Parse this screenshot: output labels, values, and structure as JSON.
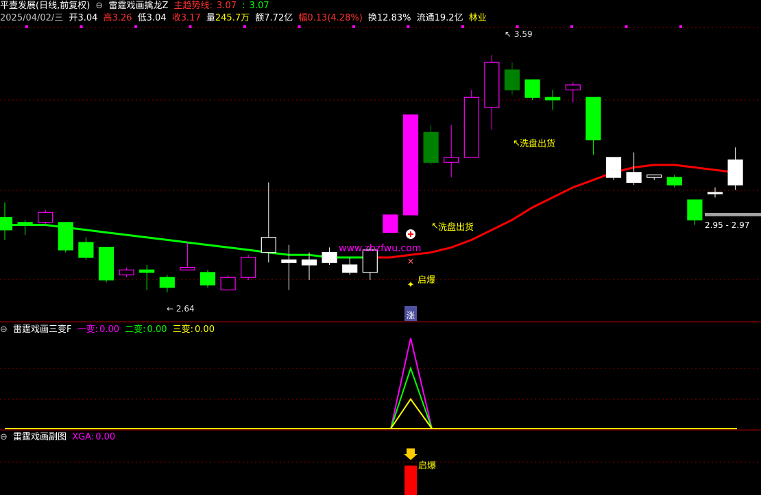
{
  "header": {
    "title": "平壹发展(日线,前复权)",
    "indicator_name": "雷霆戏画擒龙Z",
    "trend_label": "主趋势线:",
    "trend_v1": "3.07",
    "trend_v2": "3.07",
    "date": "2025/04/02/三",
    "open": "开3.04",
    "high_label": "高",
    "high_value": "3.26",
    "low_label": "低",
    "low_value": "3.04",
    "close_label": "收",
    "close_value": "3.17",
    "volume_label": "量",
    "volume_value": "245.7万",
    "amount_label": "额",
    "amount_value": "7.72亿",
    "change_label": "幅",
    "change_value": "0.13(4.28%)",
    "turnover": "换12.83%",
    "float": "流通19.2亿",
    "sector": "林业"
  },
  "panel2": {
    "name": "雷霆戏画三变F",
    "l1": "一变:",
    "v1": "0.00",
    "l2": "二变:",
    "v2": "0.00",
    "l3": "三变:",
    "v3": "0.00"
  },
  "panel3": {
    "name": "雷霆戏画副图",
    "l1": "XGA:",
    "v1": "0.00"
  },
  "annotations": {
    "high_mark": "3.59",
    "low_mark": "2.64",
    "range": "2.95 - 2.97",
    "wash1": "洗盘出货",
    "wash2": "洗盘出货",
    "qibao1": "启爆",
    "qibao2": "启爆",
    "zhang": "涨",
    "watermark": "www.zbzfwu.com"
  },
  "colors": {
    "up": "#ff00ff",
    "down_bright": "#00ff00",
    "down_dark": "#008000",
    "white": "#ffffff",
    "ma_up": "#ff0000",
    "ma_down": "#00ff00",
    "text_red": "#ff3030",
    "text_yellow": "#ffff00",
    "text_magenta": "#ff00ff",
    "grid": "#8b0000"
  },
  "chart_data": {
    "type": "candlestick",
    "candles": [
      {
        "open": 2.94,
        "close": 2.89,
        "high": 3.0,
        "low": 2.85
      },
      {
        "open": 2.92,
        "close": 2.91,
        "high": 2.93,
        "low": 2.87
      },
      {
        "open": 2.92,
        "close": 2.96,
        "high": 2.97,
        "low": 2.91
      },
      {
        "open": 2.92,
        "close": 2.81,
        "high": 2.92,
        "low": 2.8
      },
      {
        "open": 2.84,
        "close": 2.78,
        "high": 2.86,
        "low": 2.77
      },
      {
        "open": 2.82,
        "close": 2.69,
        "high": 2.82,
        "low": 2.68
      },
      {
        "open": 2.71,
        "close": 2.73,
        "high": 2.74,
        "low": 2.7
      },
      {
        "open": 2.73,
        "close": 2.72,
        "high": 2.75,
        "low": 2.65
      },
      {
        "open": 2.7,
        "close": 2.66,
        "high": 2.71,
        "low": 2.64
      },
      {
        "open": 2.73,
        "close": 2.74,
        "high": 2.84,
        "low": 2.73
      },
      {
        "open": 2.72,
        "close": 2.67,
        "high": 2.73,
        "low": 2.66
      },
      {
        "open": 2.65,
        "close": 2.7,
        "high": 2.71,
        "low": 2.65
      },
      {
        "open": 2.7,
        "close": 2.78,
        "high": 2.79,
        "low": 2.69
      },
      {
        "open": 2.8,
        "close": 2.86,
        "high": 3.08,
        "low": 2.76
      },
      {
        "open": 2.77,
        "close": 2.76,
        "high": 2.83,
        "low": 2.65
      },
      {
        "open": 2.77,
        "close": 2.75,
        "high": 2.8,
        "low": 2.69
      },
      {
        "open": 2.8,
        "close": 2.76,
        "high": 2.82,
        "low": 2.75
      },
      {
        "open": 2.75,
        "close": 2.72,
        "high": 2.78,
        "low": 2.71
      },
      {
        "open": 2.72,
        "close": 2.81,
        "high": 2.82,
        "low": 2.69
      },
      {
        "open": 2.88,
        "close": 2.95,
        "high": 2.95,
        "low": 2.88
      },
      {
        "open": 2.95,
        "close": 3.35,
        "high": 3.35,
        "low": 2.95
      },
      {
        "open": 3.28,
        "close": 3.16,
        "high": 3.31,
        "low": 3.15
      },
      {
        "open": 3.16,
        "close": 3.18,
        "high": 3.31,
        "low": 3.1
      },
      {
        "open": 3.18,
        "close": 3.42,
        "high": 3.45,
        "low": 3.18
      },
      {
        "open": 3.38,
        "close": 3.56,
        "high": 3.59,
        "low": 3.29
      },
      {
        "open": 3.53,
        "close": 3.45,
        "high": 3.56,
        "low": 3.43
      },
      {
        "open": 3.49,
        "close": 3.42,
        "high": 3.49,
        "low": 3.41
      },
      {
        "open": 3.42,
        "close": 3.41,
        "high": 3.45,
        "low": 3.37
      },
      {
        "open": 3.45,
        "close": 3.47,
        "high": 3.48,
        "low": 3.4
      },
      {
        "open": 3.42,
        "close": 3.25,
        "high": 3.42,
        "low": 3.19
      },
      {
        "open": 3.18,
        "close": 3.1,
        "high": 3.18,
        "low": 3.09
      },
      {
        "open": 3.12,
        "close": 3.08,
        "high": 3.2,
        "low": 3.07
      },
      {
        "open": 3.1,
        "close": 3.11,
        "high": 3.11,
        "low": 3.09
      },
      {
        "open": 3.1,
        "close": 3.07,
        "high": 3.11,
        "low": 3.06
      },
      {
        "open": 3.01,
        "close": 2.93,
        "high": 3.01,
        "low": 2.91
      },
      {
        "open": 3.04,
        "close": 3.04,
        "high": 3.06,
        "low": 3.02
      },
      {
        "open": 3.17,
        "close": 3.07,
        "high": 3.22,
        "low": 3.05
      }
    ],
    "ma": [
      2.91,
      2.91,
      2.91,
      2.9,
      2.89,
      2.88,
      2.87,
      2.86,
      2.85,
      2.84,
      2.83,
      2.82,
      2.81,
      2.8,
      2.79,
      2.79,
      2.78,
      2.78,
      2.78,
      2.78,
      2.79,
      2.8,
      2.82,
      2.85,
      2.89,
      2.93,
      2.98,
      3.02,
      3.06,
      3.09,
      3.12,
      3.14,
      3.15,
      3.15,
      3.14,
      3.13,
      3.12
    ],
    "ma_color_switch": 18,
    "ylim": [
      2.55,
      3.7
    ],
    "signal_index": 20
  }
}
